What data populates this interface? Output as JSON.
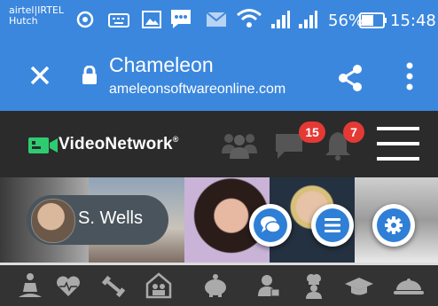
{
  "status_bar": {
    "carrier_line1": "airtel|IRTEL",
    "carrier_line2": "Hutch",
    "battery_percent": "56%",
    "time": "15:48",
    "icons": [
      "hotspot-icon",
      "keyboard-icon",
      "gallery-icon",
      "messenger-icon",
      "mail-icon",
      "wifi-icon",
      "signal-icon",
      "signal-icon",
      "battery-icon"
    ]
  },
  "browser": {
    "page_title": "Chameleon",
    "url": "ameleonsoftwareonline.com",
    "icons": [
      "close-icon",
      "lock-icon",
      "share-icon",
      "more-icon"
    ]
  },
  "app_header": {
    "brand_name": "VideoNetwork",
    "brand_mark": "®",
    "notifications": {
      "messages_count": "15",
      "alerts_count": "7"
    },
    "icons": [
      "group-icon",
      "chat-bubble-icon",
      "bell-icon",
      "hamburger-icon"
    ]
  },
  "profile": {
    "name": "S. Wells",
    "actions": [
      "chat-icon",
      "menu-icon",
      "settings-icon"
    ]
  },
  "categories": [
    "yoga-icon",
    "health-heart-icon",
    "fitness-dumbbell-icon",
    "family-home-icon",
    "savings-piggy-icon",
    "user-account-icon",
    "chef-icon",
    "education-cap-icon",
    "food-dish-icon"
  ],
  "colors": {
    "browser_bar": "#3b87de",
    "header_bg": "#2b2b2b",
    "brand_green": "#2ecc71",
    "badge_red": "#e53935",
    "action_blue": "#2f7fd6"
  }
}
